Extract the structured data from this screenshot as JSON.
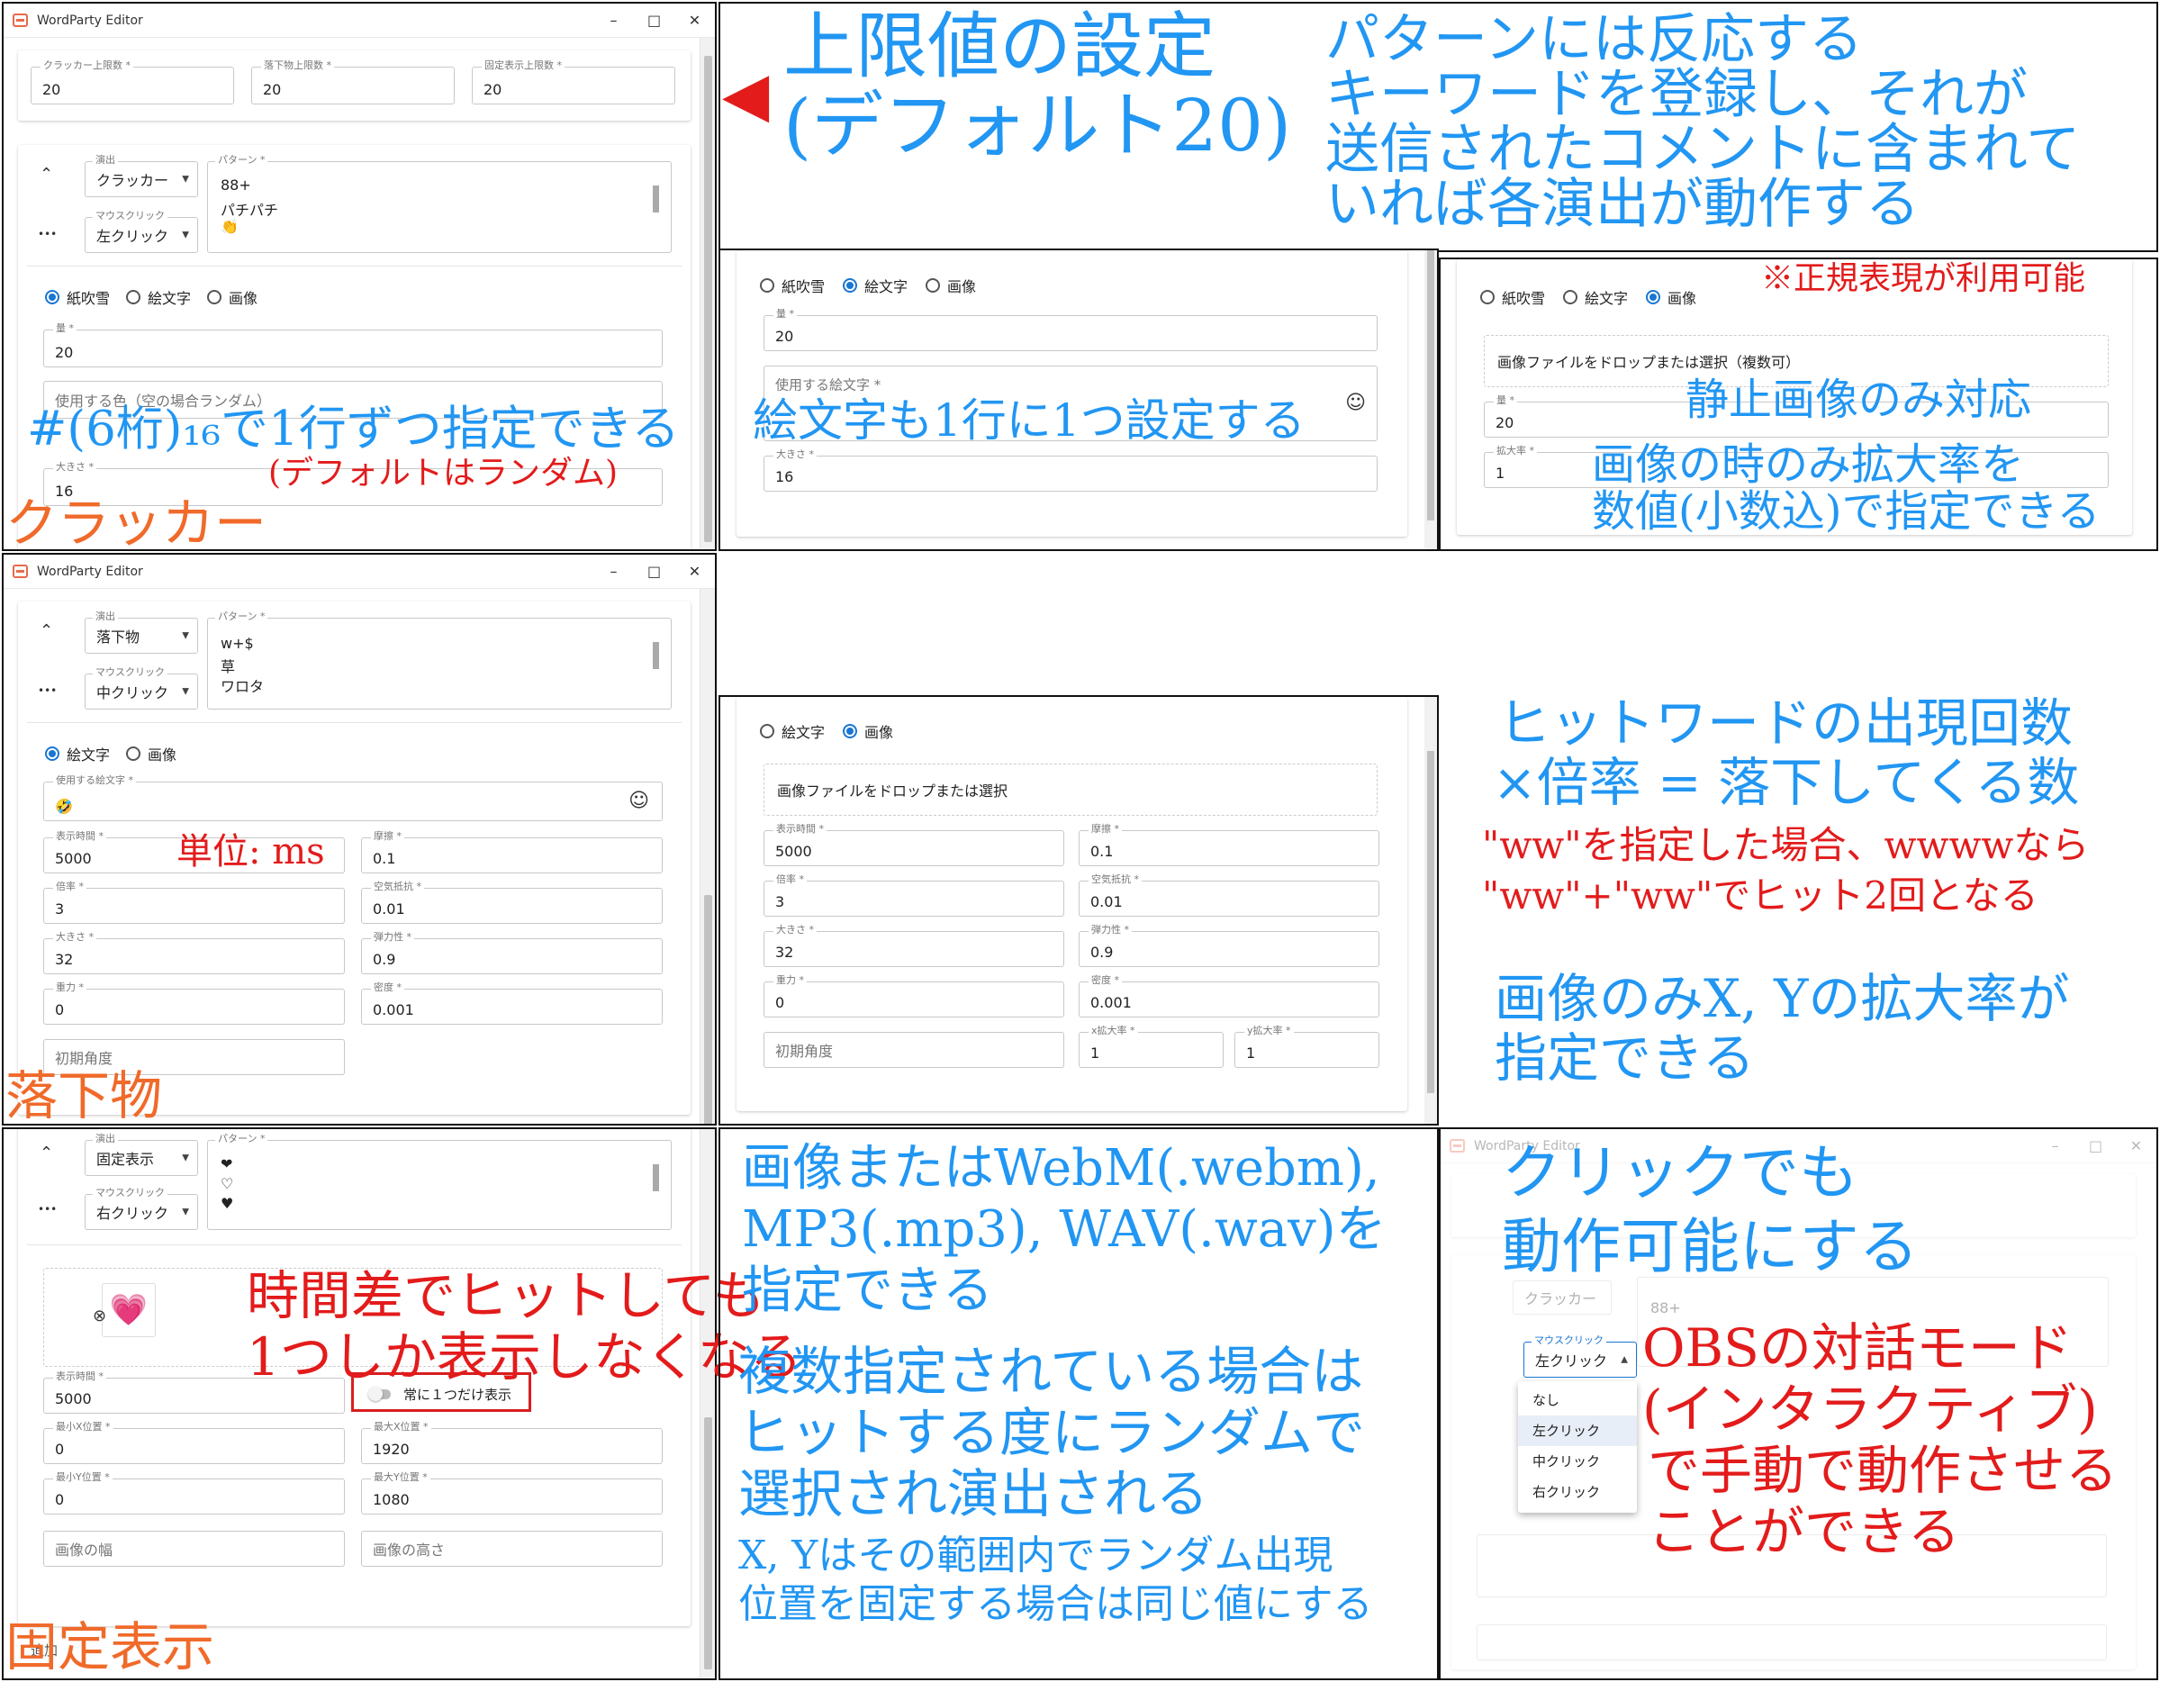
{
  "app": {
    "title": "WordParty Editor",
    "min": "–",
    "max": "□",
    "close": "✕"
  },
  "p1": {
    "limits": [
      {
        "label": "クラッカー上限数 *",
        "value": "20"
      },
      {
        "label": "落下物上限数 *",
        "value": "20"
      },
      {
        "label": "固定表示上限数 *",
        "value": "20"
      }
    ],
    "collapse": "⌃",
    "more": "•••",
    "effect": {
      "label": "演出",
      "value": "クラッカー"
    },
    "mouse": {
      "label": "マウスクリック",
      "value": "左クリック"
    },
    "pattern": {
      "label": "パターン *",
      "lines": [
        "88+",
        "パチパチ",
        "👏"
      ]
    },
    "radios": [
      "紙吹雪",
      "絵文字",
      "画像"
    ],
    "qty": {
      "label": "量 *",
      "value": "20"
    },
    "color": {
      "placeholder": "使用する色（空の場合ランダム）"
    },
    "size": {
      "label": "大きさ *",
      "value": "16"
    }
  },
  "p2": {
    "radios": [
      "紙吹雪",
      "絵文字",
      "画像"
    ],
    "qty": {
      "label": "量 *",
      "value": "20"
    },
    "emoji": {
      "label": "使用する絵文字 *"
    },
    "size": {
      "label": "大きさ *",
      "value": "16"
    },
    "smile": "☺"
  },
  "p3": {
    "radios": [
      "紙吹雪",
      "絵文字",
      "画像"
    ],
    "drop": "画像ファイルをドロップまたは選択（複数可）",
    "qty": {
      "label": "量 *",
      "value": "20"
    },
    "scale": {
      "label": "拡大率 *",
      "value": "1"
    }
  },
  "p4": {
    "collapse": "⌃",
    "more": "•••",
    "effect": {
      "label": "演出",
      "value": "落下物"
    },
    "mouse": {
      "label": "マウスクリック",
      "value": "中クリック"
    },
    "pattern": {
      "label": "パターン *",
      "lines": [
        "w+$",
        "草",
        "ワロタ"
      ]
    },
    "radios": [
      "絵文字",
      "画像"
    ],
    "emoji": {
      "label": "使用する絵文字 *",
      "value": "🤣"
    },
    "smile": "☺",
    "fields": [
      {
        "label": "表示時間 *",
        "value": "5000"
      },
      {
        "label": "摩擦 *",
        "value": "0.1"
      },
      {
        "label": "倍率 *",
        "value": "3"
      },
      {
        "label": "空気抵抗 *",
        "value": "0.01"
      },
      {
        "label": "大きさ *",
        "value": "32"
      },
      {
        "label": "弾力性 *",
        "value": "0.9"
      },
      {
        "label": "重力 *",
        "value": "0"
      },
      {
        "label": "密度 *",
        "value": "0.001"
      }
    ],
    "angle": {
      "placeholder": "初期角度"
    }
  },
  "p5": {
    "radios": [
      "絵文字",
      "画像"
    ],
    "drop": "画像ファイルをドロップまたは選択",
    "fields": [
      {
        "label": "表示時間 *",
        "value": "5000"
      },
      {
        "label": "摩擦 *",
        "value": "0.1"
      },
      {
        "label": "倍率 *",
        "value": "3"
      },
      {
        "label": "空気抵抗 *",
        "value": "0.01"
      },
      {
        "label": "大きさ *",
        "value": "32"
      },
      {
        "label": "弾力性 *",
        "value": "0.9"
      },
      {
        "label": "重力 *",
        "value": "0"
      },
      {
        "label": "密度 *",
        "value": "0.001"
      }
    ],
    "angle": {
      "placeholder": "初期角度"
    },
    "xscale": {
      "label": "x拡大率 *",
      "value": "1"
    },
    "yscale": {
      "label": "y拡大率 *",
      "value": "1"
    }
  },
  "p7": {
    "collapse": "⌃",
    "more": "•••",
    "effect": {
      "label": "演出",
      "value": "固定表示"
    },
    "mouse": {
      "label": "マウスクリック",
      "value": "右クリック"
    },
    "pattern": {
      "label": "パターン *",
      "lines": [
        "❤",
        "♡",
        "♥"
      ]
    },
    "remove": "⊗",
    "heart": "💗",
    "time": {
      "label": "表示時間 *",
      "value": "5000"
    },
    "toggle": "常に１つだけ表示",
    "fields": [
      {
        "label": "最小X位置 *",
        "value": "0"
      },
      {
        "label": "最大X位置 *",
        "value": "1920"
      },
      {
        "label": "最小Y位置 *",
        "value": "0"
      },
      {
        "label": "最大Y位置 *",
        "value": "1080"
      }
    ],
    "width": {
      "placeholder": "画像の幅"
    },
    "height": {
      "placeholder": "画像の高さ"
    },
    "add": "追加"
  },
  "p9": {
    "effect": {
      "value": "クラッカー"
    },
    "mouse": {
      "label": "マウスクリック",
      "value": "左クリック"
    },
    "pattern_line": "88+",
    "menu": [
      "なし",
      "左クリック",
      "中クリック",
      "右クリック"
    ]
  },
  "annotations": {
    "arrow": "◀",
    "limit_title": "上限値の設定",
    "limit_default": "(デフォルト20)",
    "pattern_desc": [
      "パターンには反応する",
      "キーワードを登録し、それが",
      "送信されたコメントに含まれて",
      "いれば各演出が動作する"
    ],
    "color_desc": "#(6桁)₁₆で1行ずつ指定できる",
    "color_default": "(デフォルトはランダム)",
    "cracker": "クラッカー",
    "emoji_desc": "絵文字も1行に1つ設定する",
    "regex": "※正規表現が利用可能",
    "static_only": "静止画像のみ対応",
    "scale_desc": [
      "画像の時のみ拡大率を",
      "数値(小数込)で指定できる"
    ],
    "unit": "単位: ms",
    "falling": "落下物",
    "hit_desc": [
      "ヒットワードの出現回数",
      "×倍率 = 落下してくる数"
    ],
    "ww_desc": [
      "\"ww\"を指定した場合、wwwwなら",
      "\"ww\"+\"ww\"でヒット2回となる"
    ],
    "xy_desc": [
      "画像のみX, Yの拡大率が",
      "指定できる"
    ],
    "one_desc": [
      "時間差でヒットしても",
      "1つしか表示しなくなる"
    ],
    "fixed": "固定表示",
    "media_desc": [
      "画像またはWebM(.webm),",
      "MP3(.mp3), WAV(.wav)を",
      "指定できる"
    ],
    "multi_desc": [
      "複数指定されている場合は",
      "ヒットする度にランダムで",
      "選択され演出される"
    ],
    "xy_range": [
      "X, Yはその範囲内でランダム出現",
      "位置を固定する場合は同じ値にする"
    ],
    "click_desc": [
      "クリックでも",
      "動作可能にする"
    ],
    "obs_desc": [
      "OBSの対話モード",
      "(インタラクティブ)",
      "で手動で動作させる",
      "ことができる"
    ]
  },
  "colors": {
    "blue": "#2196f3",
    "red": "#e31b1b",
    "orange": "#f06a2a",
    "accent": "#1976d2"
  }
}
